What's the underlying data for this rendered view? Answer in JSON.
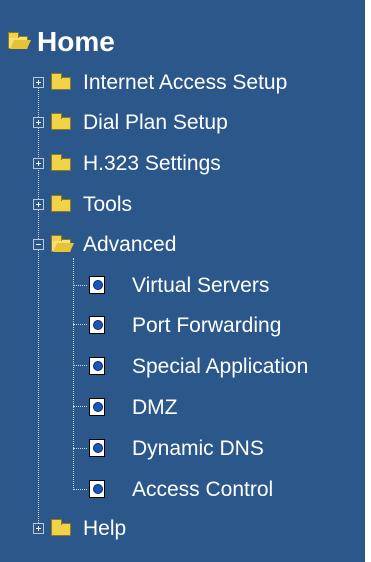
{
  "tree": {
    "root": {
      "label": "Home",
      "icon": "folder-open-icon"
    },
    "items": [
      {
        "label": "Internet Access Setup",
        "expanded": false,
        "icon": "folder-icon"
      },
      {
        "label": "Dial Plan Setup",
        "expanded": false,
        "icon": "folder-icon"
      },
      {
        "label": "H.323 Settings",
        "expanded": false,
        "icon": "folder-icon"
      },
      {
        "label": "Tools",
        "expanded": false,
        "icon": "folder-icon"
      },
      {
        "label": "Advanced",
        "expanded": true,
        "icon": "folder-open-icon",
        "children": [
          {
            "label": "Virtual Servers",
            "icon": "page-icon"
          },
          {
            "label": "Port Forwarding",
            "icon": "page-icon"
          },
          {
            "label": "Special Application",
            "icon": "page-icon"
          },
          {
            "label": "DMZ",
            "icon": "page-icon"
          },
          {
            "label": "Dynamic DNS",
            "icon": "page-icon"
          },
          {
            "label": "Access Control",
            "icon": "page-icon"
          }
        ]
      },
      {
        "label": "Help",
        "expanded": false,
        "icon": "folder-icon"
      }
    ]
  },
  "colors": {
    "panel_bg": "#2b578a",
    "text": "#ffffff",
    "folder": "#f2d347",
    "page_globe": "#1a55b8"
  }
}
